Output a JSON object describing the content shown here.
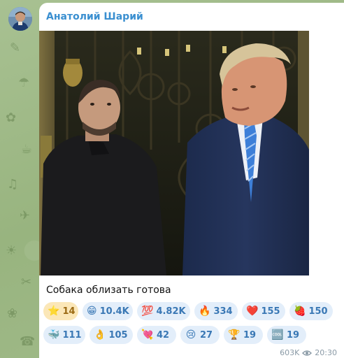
{
  "chat": {
    "sender_name": "Анатолий Шарий",
    "caption": "Собака облизать готова",
    "views": "603K",
    "time": "20:30"
  },
  "reactions": [
    {
      "emoji": "⭐",
      "icon": "star-icon",
      "count": "14",
      "chosen": true
    },
    {
      "emoji": "😁",
      "icon": "grin-icon",
      "count": "10.4K"
    },
    {
      "emoji": "💯",
      "icon": "hundred-icon",
      "count": "4.82K"
    },
    {
      "emoji": "🔥",
      "icon": "fire-icon",
      "count": "334"
    },
    {
      "emoji": "❤️",
      "icon": "heart-icon",
      "count": "155"
    },
    {
      "emoji": "🍓",
      "icon": "strawberry-icon",
      "count": "150"
    },
    {
      "emoji": "🐳",
      "icon": "whale-icon",
      "count": "111"
    },
    {
      "emoji": "👌",
      "icon": "ok-hand-icon",
      "count": "105"
    },
    {
      "emoji": "💘",
      "icon": "heart-arrow-icon",
      "count": "42"
    },
    {
      "emoji": "😢",
      "icon": "crying-face-icon",
      "count": "27"
    },
    {
      "emoji": "🏆",
      "icon": "trophy-icon",
      "count": "19"
    },
    {
      "emoji": "🆒",
      "icon": "cool-icon",
      "count": "19"
    }
  ],
  "colors": {
    "sender": "#3a8fd0",
    "reaction_bg": "#e3eefa",
    "reaction_text": "#3a78b5",
    "chosen_bg": "#fbe7b8",
    "chat_bg": "#9fb98a"
  }
}
